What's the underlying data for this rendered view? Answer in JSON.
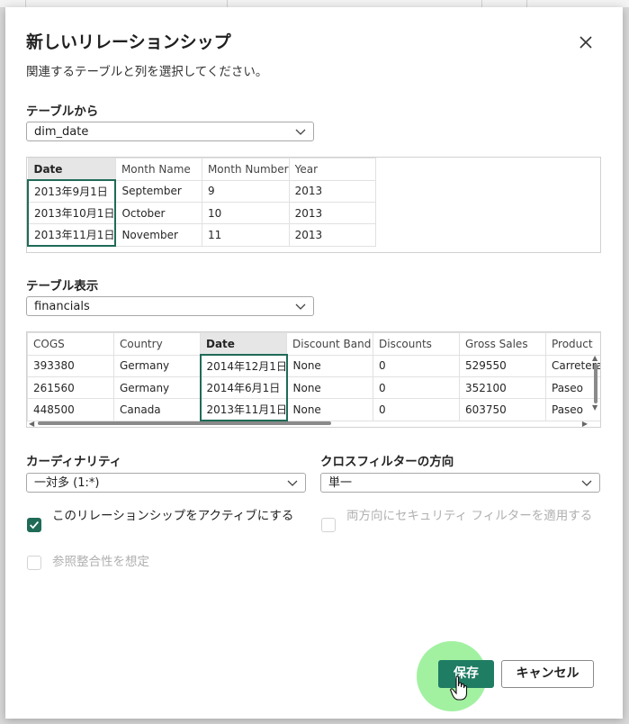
{
  "dialog": {
    "title": "新しいリレーションシップ",
    "subtitle": "関連するテーブルと列を選択してください。"
  },
  "from_table": {
    "label": "テーブルから",
    "selected": "dim_date",
    "columns": [
      "Date",
      "Month Name",
      "Month Number",
      "Year"
    ],
    "selected_column": "Date",
    "rows": [
      [
        "2013年9月1日",
        "September",
        "9",
        "2013"
      ],
      [
        "2013年10月1日",
        "October",
        "10",
        "2013"
      ],
      [
        "2013年11月1日",
        "November",
        "11",
        "2013"
      ]
    ]
  },
  "to_table": {
    "label": "テーブル表示",
    "selected": "financials",
    "columns": [
      "COGS",
      "Country",
      "Date",
      "Discount Band",
      "Discounts",
      "Gross Sales",
      "Product"
    ],
    "selected_column": "Date",
    "rows": [
      [
        "393380",
        "Germany",
        "2014年12月1日",
        "None",
        "0",
        "529550",
        "Carretera"
      ],
      [
        "261560",
        "Germany",
        "2014年6月1日",
        "None",
        "0",
        "352100",
        "Paseo"
      ],
      [
        "448500",
        "Canada",
        "2013年11月1日",
        "None",
        "0",
        "603750",
        "Paseo"
      ]
    ]
  },
  "cardinality": {
    "label": "カーディナリティ",
    "selected": "一対多 (1:*)"
  },
  "cross_filter": {
    "label": "クロスフィルターの方向",
    "selected": "単一"
  },
  "options": {
    "make_active": {
      "label": "このリレーションシップをアクティブにする",
      "checked": true
    },
    "bidirectional_security": {
      "label": "両方向にセキュリティ フィルターを適用する",
      "checked": false,
      "disabled": true
    },
    "assume_integrity": {
      "label": "参照整合性を想定",
      "checked": false,
      "disabled": true
    }
  },
  "buttons": {
    "save": "保存",
    "cancel": "キャンセル"
  },
  "colors": {
    "accent": "#1f7d64",
    "selection_border": "#1f6b57",
    "click_highlight": "#90ee90"
  },
  "icons": {
    "close": "close-icon",
    "dropdown": "chevron-down-icon",
    "checkbox": "checkmark-icon",
    "cursor": "hand-pointer-icon"
  }
}
